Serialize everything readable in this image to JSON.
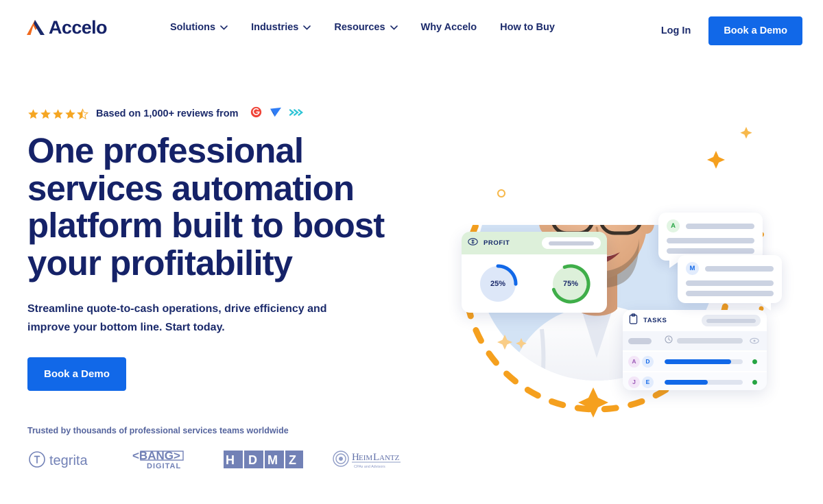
{
  "brand": {
    "name": "Accelo",
    "logo_icon": "accelo-a-mark-icon",
    "colors": {
      "navy": "#152268",
      "blue": "#1168e8",
      "orange": "#f5a01e",
      "green": "#27a544",
      "muted": "#56659e"
    }
  },
  "header": {
    "nav_items": [
      {
        "label": "Solutions",
        "has_dropdown": true,
        "icon": "chevron-down-icon"
      },
      {
        "label": "Industries",
        "has_dropdown": true,
        "icon": "chevron-down-icon"
      },
      {
        "label": "Resources",
        "has_dropdown": true,
        "icon": "chevron-down-icon"
      },
      {
        "label": "Why Accelo",
        "has_dropdown": false,
        "icon": ""
      },
      {
        "label": "How to Buy",
        "has_dropdown": false,
        "icon": ""
      }
    ],
    "login_label": "Log In",
    "cta_label": "Book a Demo"
  },
  "hero": {
    "reviews": {
      "rating": 4.5,
      "stars_full": 4,
      "stars_half": 1,
      "stars_total": 5,
      "text": "Based on 1,000+ reviews from",
      "sources": [
        {
          "name": "g2-icon",
          "color": "#f04438"
        },
        {
          "name": "capterra-icon",
          "color": "#2f7df6"
        },
        {
          "name": "getapp-icon",
          "color": "#2fc4d6"
        }
      ]
    },
    "headline": "One professional services automation platform built to boost your profitability",
    "subhead": "Streamline quote-to-cash operations, drive efficiency and improve your bottom line. Start today.",
    "cta_label": "Book a Demo",
    "trusted_text": "Trusted by thousands of professional services teams worldwide",
    "client_logos": [
      {
        "name": "tegrita-logo",
        "label": "tegrita",
        "sub": ""
      },
      {
        "name": "bang-digital-logo",
        "label": "<BANG>",
        "sub": "DIGITAL"
      },
      {
        "name": "hdmz-logo",
        "label": "HDMZ",
        "sub": ""
      },
      {
        "name": "heimlantz-logo",
        "label": "HeimLantz",
        "sub": "CPAs and Advisors"
      }
    ]
  },
  "illustration": {
    "photo_alt": "smiling-man-with-glasses",
    "profit_card": {
      "icon": "money-eye-icon",
      "title": "PROFIT",
      "donuts": [
        {
          "label": "25%",
          "value": 25,
          "color": "#1168e8",
          "track": "#dde7f8"
        },
        {
          "label": "75%",
          "value": 75,
          "color": "#3fae49",
          "track": "#ddf0da"
        }
      ]
    },
    "tasks_card": {
      "icon": "clipboard-icon",
      "title": "TASKS",
      "rows": [
        {
          "avatars": [],
          "progress": null,
          "status": null,
          "placeholder": true,
          "icons": [
            "clock-icon",
            "eye-icon"
          ]
        },
        {
          "avatars": [
            "A",
            "D"
          ],
          "progress": 85,
          "status": "#27a544",
          "placeholder": false,
          "icons": []
        },
        {
          "avatars": [
            "J",
            "E"
          ],
          "progress": 55,
          "status": "#27a544",
          "placeholder": false,
          "icons": []
        }
      ]
    },
    "chat_bubbles": [
      {
        "avatar": "A",
        "avatar_color": "#27a544",
        "lines": 3
      },
      {
        "avatar": "M",
        "avatar_color": "#1168e8",
        "lines": 3
      }
    ],
    "decorations": [
      "orange-dashed-circle",
      "orange-sparkle",
      "orange-dot",
      "orange-ring"
    ]
  }
}
